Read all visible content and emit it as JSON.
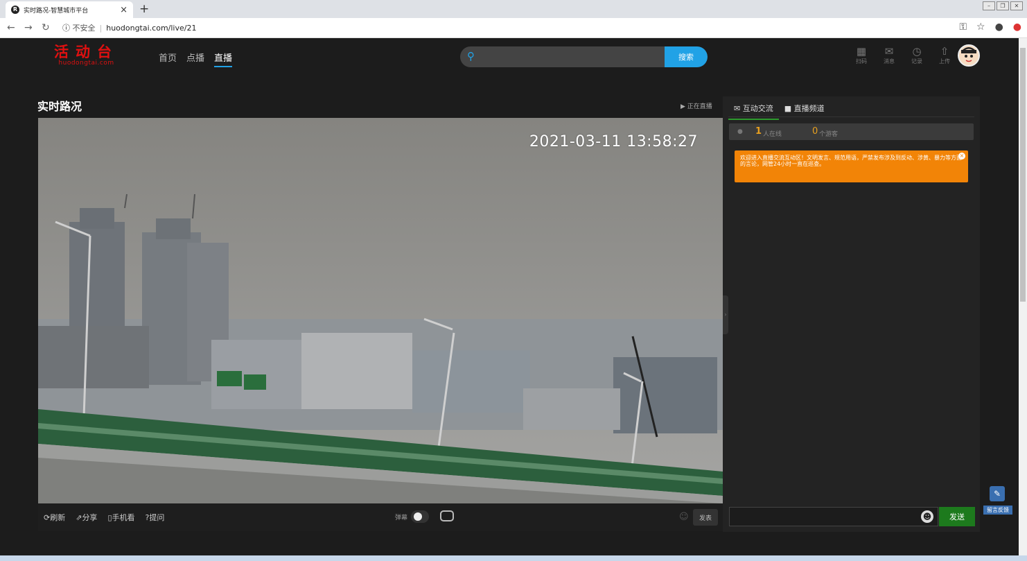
{
  "browser": {
    "tab_title": "实时路况-智慧城市平台",
    "tab_favicon": "R",
    "new_tab": "+",
    "url_warning": "不安全",
    "url": "huodongtai.com/live/21"
  },
  "header": {
    "logo_cn": "活动台",
    "logo_en": "huodongtai.com",
    "nav": [
      {
        "label": "首页",
        "active": false
      },
      {
        "label": "点播",
        "active": false
      },
      {
        "label": "直播",
        "active": true
      }
    ],
    "search_placeholder": "",
    "search_button": "搜索",
    "icons": [
      {
        "icon": "scan-icon",
        "glyph": "▦",
        "label": "扫码"
      },
      {
        "icon": "message-icon",
        "glyph": "✉",
        "label": "消息"
      },
      {
        "icon": "history-icon",
        "glyph": "◷",
        "label": "记录"
      },
      {
        "icon": "upload-icon",
        "glyph": "⇧",
        "label": "上传"
      }
    ]
  },
  "main": {
    "title": "实时路况",
    "live_status": "正在直播",
    "timestamp": "2021-03-11 13:58:27",
    "controls": [
      "刷新",
      "分享",
      "手机看",
      "提问"
    ],
    "danmu_label": "弹幕",
    "send_small": "发表"
  },
  "chat": {
    "tabs": [
      {
        "label": "互动交流",
        "active": true
      },
      {
        "label": "直播频道",
        "active": false
      }
    ],
    "online_count": "1",
    "online_label": "人在线",
    "guest_count": "0",
    "guest_label": "个游客",
    "notice": "欢迎进入直播交流互动区！文明发言、规范用语，严禁发布涉及到反动、涉黄、暴力等方面的言论，网管24小时一直在巡查。",
    "send_button": "发送"
  },
  "feedback": {
    "label": "留言反馈"
  },
  "colors": {
    "accent": "#21a2e6",
    "logo_red": "#e01010",
    "notice_orange": "#f28407",
    "send_green": "#1d7a1d"
  }
}
